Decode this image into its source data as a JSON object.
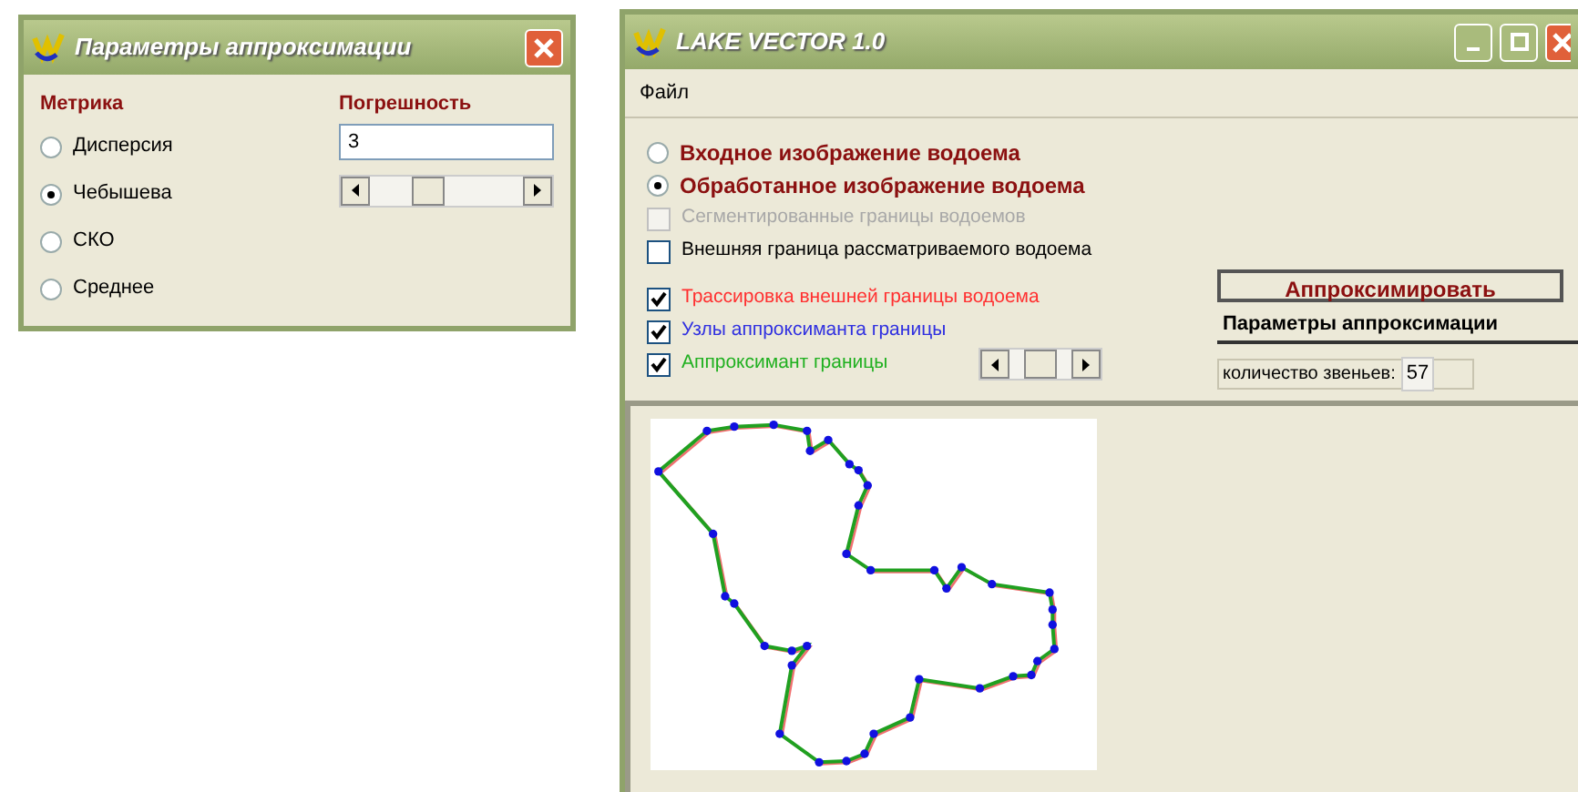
{
  "dialog": {
    "title": "Параметры аппроксимации",
    "metric": {
      "label": "Метрика",
      "options": [
        {
          "label": "Дисперсия",
          "selected": false
        },
        {
          "label": "Чебышева",
          "selected": true
        },
        {
          "label": "СКО",
          "selected": false
        },
        {
          "label": "Среднее",
          "selected": false
        }
      ]
    },
    "tolerance": {
      "label": "Погрешность",
      "value": "3",
      "level": 0.35
    }
  },
  "main_window": {
    "title": "LAKE VECTOR 1.0",
    "menu": [
      "Файл"
    ],
    "view_options": [
      {
        "label": "Входное изображение водоема",
        "selected": false
      },
      {
        "label": "Обработанное изображение водоема",
        "selected": true
      }
    ],
    "layers": [
      {
        "label": "Сегментированные границы водоемов",
        "checked": false,
        "disabled": true
      },
      {
        "label": "Внешняя граница рассматриваемого водоема",
        "checked": false,
        "disabled": false
      },
      {
        "label": "Трассировка внешней границы водоема",
        "checked": true,
        "disabled": false,
        "color": "#ff3030"
      },
      {
        "label": "Узлы аппроксиманта границы",
        "checked": true,
        "disabled": false,
        "color": "#3030e0"
      },
      {
        "label": "Аппроксимант границы",
        "checked": true,
        "disabled": false,
        "color": "#20b020"
      }
    ],
    "layer_slider": {
      "level": 0.5
    },
    "approximate_button": "Аппроксимировать",
    "params_button": "Параметры аппроксимации",
    "segments": {
      "label": "количество звеньев:",
      "value": "57"
    }
  }
}
